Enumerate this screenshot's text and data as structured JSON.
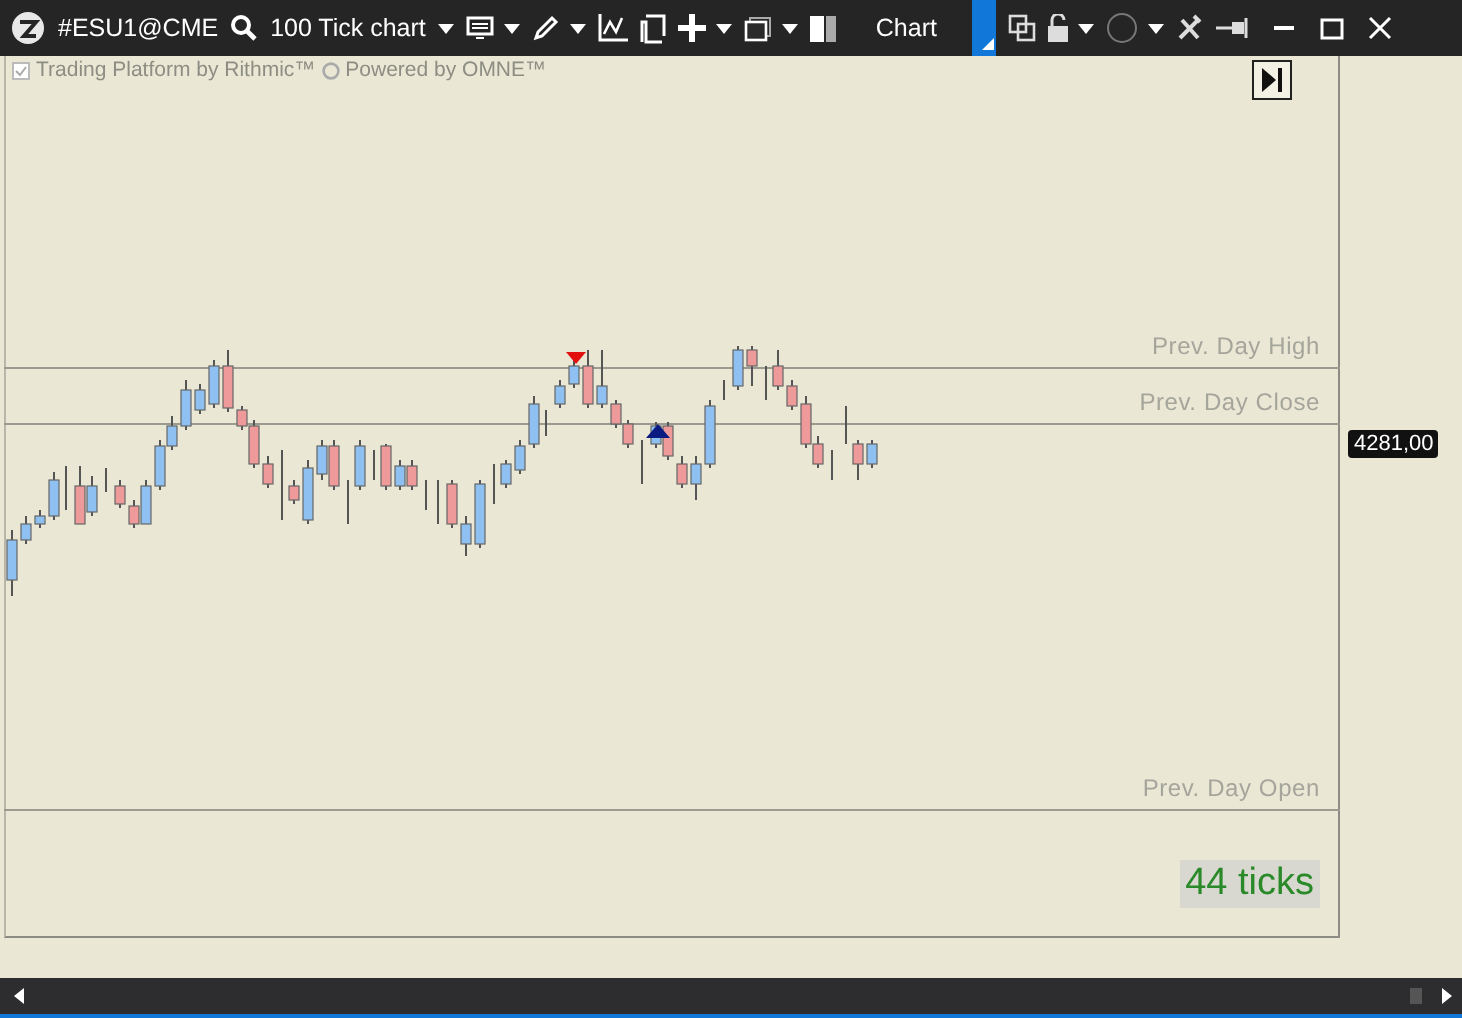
{
  "toolbar": {
    "symbol": "#ESU1@CME",
    "chart_type": "100 Tick chart",
    "tab_label": "Chart"
  },
  "chart": {
    "branding": [
      "Trading Platform by Rithmic™",
      "Powered by OMNE™"
    ],
    "reference_lines": [
      {
        "label": "Prev. Day High"
      },
      {
        "label": "Prev. Day Close"
      },
      {
        "label": "Prev. Day Open"
      }
    ],
    "last_price": "4281,00",
    "tick_counter": "44 ticks"
  }
}
